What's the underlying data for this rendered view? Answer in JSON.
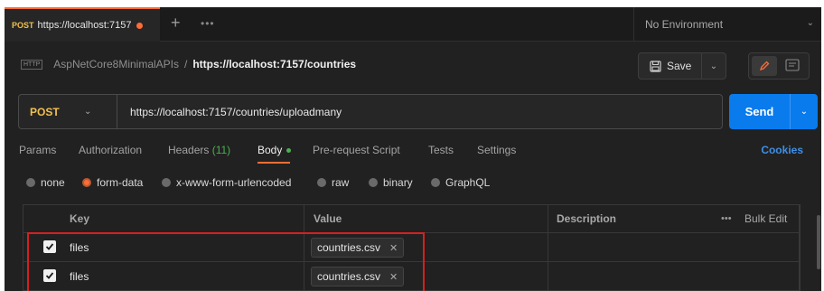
{
  "tab": {
    "method": "POST",
    "url": "https://localhost:7157"
  },
  "environment": {
    "label": "No Environment"
  },
  "breadcrumb": {
    "collection": "AspNetCore8MinimalAPIs",
    "separator": "/",
    "request": "https://localhost:7157/countries"
  },
  "toolbar": {
    "save_label": "Save"
  },
  "request": {
    "method": "POST",
    "url": "https://localhost:7157/countries/uploadmany",
    "send_label": "Send"
  },
  "req_tabs": {
    "params": "Params",
    "authorization": "Authorization",
    "headers": "Headers",
    "headers_count": "(11)",
    "body": "Body",
    "prerequest": "Pre-request Script",
    "tests": "Tests",
    "settings": "Settings",
    "cookies": "Cookies"
  },
  "body_modes": {
    "none": "none",
    "form_data": "form-data",
    "urlencoded": "x-www-form-urlencoded",
    "raw": "raw",
    "binary": "binary",
    "graphql": "GraphQL",
    "selected": "form-data"
  },
  "table": {
    "headers": {
      "key": "Key",
      "value": "Value",
      "description": "Description",
      "bulk_edit": "Bulk Edit"
    },
    "rows": [
      {
        "checked": true,
        "key": "files",
        "value": "countries.csv"
      },
      {
        "checked": true,
        "key": "files",
        "value": "countries.csv"
      }
    ]
  },
  "colors": {
    "accent": "#ff6c37",
    "send": "#097bed",
    "method": "#f2c14e",
    "body_dot": "#4caf50",
    "highlight": "#d62020"
  }
}
